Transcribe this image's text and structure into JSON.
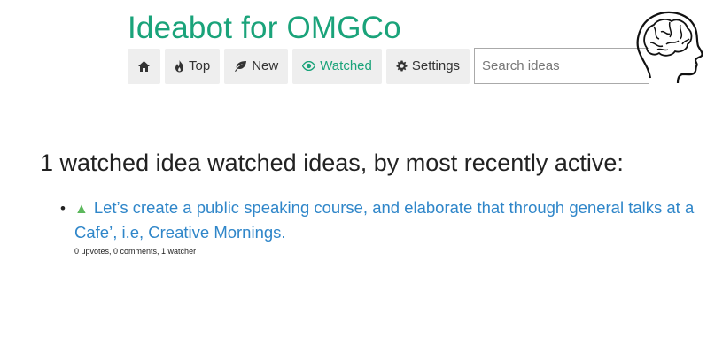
{
  "app": {
    "title": "Ideabot for OMGCo"
  },
  "nav": {
    "home_icon": "home-icon",
    "top_label": "Top",
    "top_icon": "fire-icon",
    "new_label": "New",
    "new_icon": "leaf-icon",
    "watched_label": "Watched",
    "watched_icon": "eye-icon",
    "settings_label": "Settings",
    "settings_icon": "gear-icon",
    "active_tab": "Watched"
  },
  "search": {
    "placeholder": "Search ideas",
    "value": ""
  },
  "heading": "1 watched idea watched ideas, by most recently active:",
  "ideas": [
    {
      "title": "Let’s create a public speaking course, and elaborate that through general talks at a Cafe’, i.e, Creative Mornings.",
      "meta": "0 upvotes, 0 comments, 1 watcher"
    }
  ],
  "colors": {
    "brand": "#1aa37a",
    "link": "#2f86c9",
    "upvote": "#5cb85c",
    "nav_bg": "#eeeeee"
  }
}
